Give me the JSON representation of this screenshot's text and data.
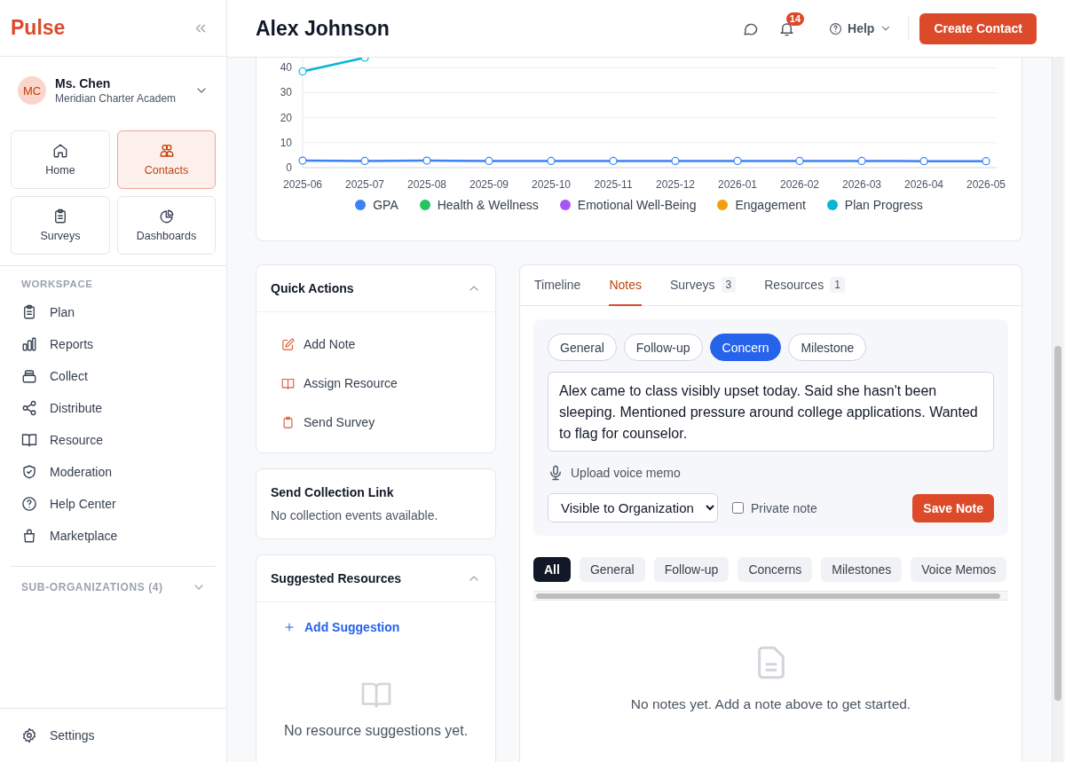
{
  "sidebar": {
    "logo": "Pulse",
    "user": {
      "initials": "MC",
      "name": "Ms. Chen",
      "org": "Meridian Charter Academ"
    },
    "tiles": [
      {
        "label": "Home",
        "selected": false
      },
      {
        "label": "Contacts",
        "selected": true
      },
      {
        "label": "Surveys",
        "selected": false
      },
      {
        "label": "Dashboards",
        "selected": false
      }
    ],
    "workspace": {
      "heading": "WORKSPACE",
      "items": [
        "Plan",
        "Reports",
        "Collect",
        "Distribute",
        "Resource",
        "Moderation",
        "Help Center",
        "Marketplace"
      ]
    },
    "sub_organizations": {
      "label": "SUB-ORGANIZATIONS (4)",
      "expanded": false
    },
    "footer_item": "Settings"
  },
  "header": {
    "title": "Alex Johnson",
    "notifications": "14",
    "help": "Help",
    "primary_button": "Create Contact"
  },
  "chart": {
    "chart_data": {
      "type": "line",
      "categories": [
        "2025-06",
        "2025-07",
        "2025-08",
        "2025-09",
        "2025-10",
        "2025-11",
        "2025-12",
        "2026-01",
        "2026-02",
        "2026-03",
        "2026-04",
        "2026-05"
      ],
      "ylim": [
        0,
        44
      ],
      "yticks": [
        0,
        10,
        20,
        30,
        40
      ],
      "grid": true,
      "legend": true,
      "series": [
        {
          "name": "GPA",
          "color": "#3b82f6",
          "marker": "circle",
          "values": [
            2.8,
            2.7,
            2.8,
            2.7,
            2.7,
            2.7,
            2.7,
            2.7,
            2.7,
            2.7,
            2.6,
            2.6
          ]
        },
        {
          "name": "Health & Wellness",
          "color": "#22c55e",
          "values": [
            null,
            null,
            null,
            null,
            null,
            null,
            null,
            null,
            null,
            null,
            null,
            null
          ]
        },
        {
          "name": "Emotional Well-Being",
          "color": "#a855f7",
          "values": [
            null,
            null,
            null,
            null,
            null,
            null,
            null,
            null,
            null,
            null,
            null,
            null
          ]
        },
        {
          "name": "Engagement",
          "color": "#f59e0b",
          "values": [
            null,
            null,
            null,
            null,
            null,
            null,
            null,
            null,
            null,
            null,
            null,
            null
          ]
        },
        {
          "name": "Plan Progress",
          "color": "#06b6d4",
          "marker": "circle",
          "values": [
            38.5,
            44,
            null,
            null,
            null,
            null,
            null,
            null,
            null,
            null,
            null,
            null
          ]
        }
      ]
    }
  },
  "quick_actions": {
    "title": "Quick Actions",
    "expanded": true,
    "items": [
      "Add Note",
      "Assign Resource",
      "Send Survey"
    ]
  },
  "collection_link": {
    "title": "Send Collection Link",
    "message": "No collection events available."
  },
  "suggested_resources": {
    "title": "Suggested Resources",
    "expanded": true,
    "action": "Add Suggestion",
    "empty": "No resource suggestions yet."
  },
  "activity": {
    "tabs": [
      {
        "label": "Timeline",
        "selected": false
      },
      {
        "label": "Notes",
        "selected": true
      },
      {
        "label": "Surveys",
        "count": "3",
        "selected": false
      },
      {
        "label": "Resources",
        "count": "1",
        "selected": false
      }
    ],
    "note_types": [
      {
        "label": "General",
        "selected": false
      },
      {
        "label": "Follow-up",
        "selected": false
      },
      {
        "label": "Concern",
        "selected": true
      },
      {
        "label": "Milestone",
        "selected": false
      }
    ],
    "note": {
      "value": "Alex came to class visibly upset today. Said she hasn't been sleeping. Mentioned pressure around college applications. Wanted to flag for counselor."
    },
    "voice_memo": "Upload voice memo",
    "visibility": {
      "value": "Visible to Organization"
    },
    "private_note": {
      "label": "Private note",
      "checked": false
    },
    "save_button": "Save Note",
    "filters": [
      {
        "label": "All",
        "selected": true
      },
      {
        "label": "General",
        "selected": false
      },
      {
        "label": "Follow-up",
        "selected": false
      },
      {
        "label": "Concerns",
        "selected": false
      },
      {
        "label": "Milestones",
        "selected": false
      },
      {
        "label": "Voice Memos",
        "selected": false
      }
    ],
    "empty": "No notes yet. Add a note above to get started."
  }
}
